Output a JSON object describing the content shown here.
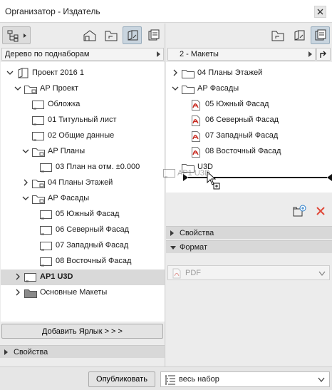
{
  "window": {
    "title": "Организатор - Издатель"
  },
  "left": {
    "view_selector": "Дерево по поднаборам",
    "tree": [
      {
        "label": "Проект 2016 1",
        "icon": "project-book-icon",
        "expanded": true,
        "bold": false
      },
      {
        "label": "АР Проект",
        "icon": "folder-subset-icon",
        "expanded": true,
        "bold": false
      },
      {
        "label": "Обложка",
        "icon": "layout-icon",
        "bold": false
      },
      {
        "label": "01 Титульный лист",
        "icon": "layout-icon",
        "bold": false
      },
      {
        "label": "02 Общие данные",
        "icon": "layout-icon",
        "bold": false
      },
      {
        "label": "АР Планы",
        "icon": "folder-subset-icon",
        "expanded": true,
        "bold": false
      },
      {
        "label": "03 План на отм. ±0.000",
        "icon": "layout-icon",
        "bold": false
      },
      {
        "label": "04 Планы Этажей",
        "icon": "folder-subset-icon",
        "expanded": false,
        "bold": false
      },
      {
        "label": "АР Фасады",
        "icon": "folder-subset-icon",
        "expanded": true,
        "bold": false
      },
      {
        "label": "05 Южный Фасад",
        "icon": "layout-icon",
        "bold": false
      },
      {
        "label": "06 Северный Фасад",
        "icon": "layout-icon",
        "bold": false
      },
      {
        "label": "07 Западный Фасад",
        "icon": "layout-icon",
        "bold": false
      },
      {
        "label": "08 Восточный Фасад",
        "icon": "layout-icon",
        "bold": false
      },
      {
        "label": "AP1 U3D",
        "icon": "layout-icon",
        "expanded": false,
        "bold": true,
        "selected": true
      },
      {
        "label": "Основные Макеты",
        "icon": "folder-dark-icon",
        "expanded": false,
        "bold": false
      }
    ],
    "add_shortcut_label": "Добавить Ярлык > > >",
    "properties_label": "Свойства"
  },
  "right": {
    "set_selector": "2 - Макеты",
    "tree": [
      {
        "label": "04 Планы Этажей",
        "icon": "folder-icon",
        "expanded": false
      },
      {
        "label": "АР Фасады",
        "icon": "folder-icon",
        "expanded": true
      },
      {
        "label": "05 Южный Фасад",
        "icon": "pdf-icon"
      },
      {
        "label": "06 Северный Фасад",
        "icon": "pdf-icon"
      },
      {
        "label": "07 Западный Фасад",
        "icon": "pdf-icon"
      },
      {
        "label": "08 Восточный Фасад",
        "icon": "pdf-icon"
      },
      {
        "label": "U3D",
        "icon": "folder-icon"
      }
    ],
    "drag_ghost_label": "AP1 U3D",
    "properties_label": "Свойства",
    "format_label": "Формат",
    "format_value": "PDF"
  },
  "footer": {
    "publish_label": "Опубликовать",
    "scope_value": "весь набор"
  },
  "colors": {
    "accent_active": "#c9d5df",
    "delete_red": "#e04a3a",
    "pdf_red": "#c8281e",
    "selection": "#d9d9d9"
  }
}
